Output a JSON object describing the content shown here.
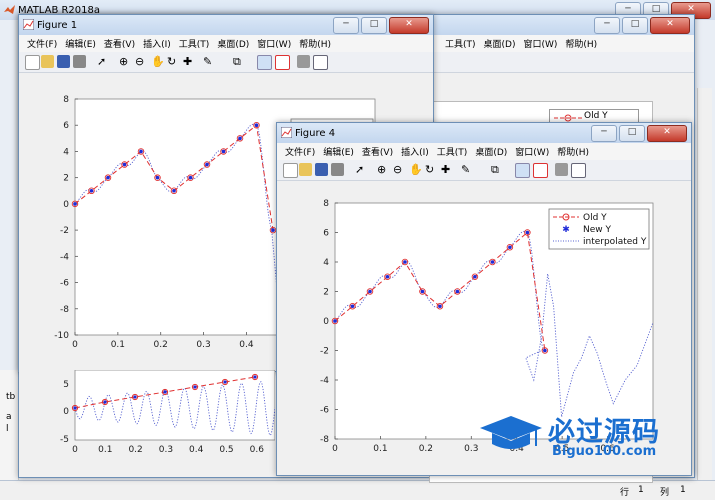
{
  "app": {
    "title": "MATLAB R2018a",
    "status": {
      "row_label": "行",
      "row_value": "1",
      "col_label": "列",
      "col_value": "1"
    },
    "left_fragments": [
      "tb",
      "a",
      "l"
    ]
  },
  "figure1": {
    "title": "Figure 1",
    "menu": [
      "文件(F)",
      "编辑(E)",
      "查看(V)",
      "插入(I)",
      "工具(T)",
      "桌面(D)",
      "窗口(W)",
      "帮助(H)"
    ],
    "legend": {
      "old": "Old Y",
      "new": "New Y"
    },
    "xticks": [
      "0",
      "0.1",
      "0.2",
      "0.3",
      "0.4",
      "0.5",
      "0.6"
    ],
    "yticks": [
      "8",
      "6",
      "4",
      "2",
      "0",
      "-2",
      "-4",
      "-6",
      "-8",
      "-10"
    ],
    "lower_yticks": [
      "5",
      "0",
      "-5"
    ],
    "lower_xticks": [
      "0",
      "0.1",
      "0.2",
      "0.3",
      "0.4",
      "0.5",
      "0.6"
    ]
  },
  "figure_back": {
    "menu": [
      "工具(T)",
      "桌面(D)",
      "窗口(W)",
      "帮助(H)"
    ],
    "legend_old": "Old Y"
  },
  "figure4": {
    "title": "Figure 4",
    "menu": [
      "文件(F)",
      "编辑(E)",
      "查看(V)",
      "插入(I)",
      "工具(T)",
      "桌面(D)",
      "窗口(W)",
      "帮助(H)"
    ],
    "legend": {
      "old": "Old Y",
      "new": "New Y",
      "interp": "interpolated Y"
    },
    "xticks": [
      "0",
      "0.1",
      "0.2",
      "0.3",
      "0.4",
      "0.5",
      "0.6"
    ],
    "yticks": [
      "8",
      "6",
      "4",
      "2",
      "0",
      "-2",
      "-4",
      "-6",
      "-8"
    ]
  },
  "watermark": {
    "cn": "必过源码",
    "en": "Biguo100.com"
  },
  "colors": {
    "old": "#e03030",
    "new": "#1f2bd8",
    "interp": "#5560d0"
  },
  "chart_data": [
    {
      "type": "line",
      "x": [
        0,
        0.0385,
        0.077,
        0.1155,
        0.154,
        0.1925,
        0.231,
        0.2695,
        0.308,
        0.3465,
        0.385,
        0.4235,
        0.462
      ],
      "series": [
        {
          "name": "Old Y",
          "values": [
            0,
            1,
            2,
            3,
            4,
            2,
            1,
            2,
            3,
            4,
            5,
            6,
            -2
          ]
        },
        {
          "name": "New Y",
          "values": [
            0,
            1,
            2,
            3,
            4,
            2,
            1,
            2,
            3,
            4,
            5,
            6,
            -2
          ]
        }
      ],
      "xlim": [
        0,
        0.7
      ],
      "ylim": [
        -10,
        8
      ]
    },
    {
      "type": "line",
      "x": [
        0,
        0.0385,
        0.077,
        0.1155,
        0.154,
        0.1925,
        0.231,
        0.2695,
        0.308,
        0.3465,
        0.385,
        0.4235,
        0.462
      ],
      "series": [
        {
          "name": "Old Y",
          "values": [
            0,
            1,
            2,
            3,
            4,
            2,
            1,
            2,
            3,
            4,
            5,
            6,
            -2
          ]
        },
        {
          "name": "New Y",
          "values": [
            0,
            1,
            2,
            3,
            4,
            2,
            1,
            2,
            3,
            4,
            5,
            6,
            -2
          ]
        },
        {
          "name": "interpolated Y",
          "values": []
        }
      ],
      "xlim": [
        0,
        0.7
      ],
      "ylim": [
        -8,
        8
      ]
    }
  ]
}
